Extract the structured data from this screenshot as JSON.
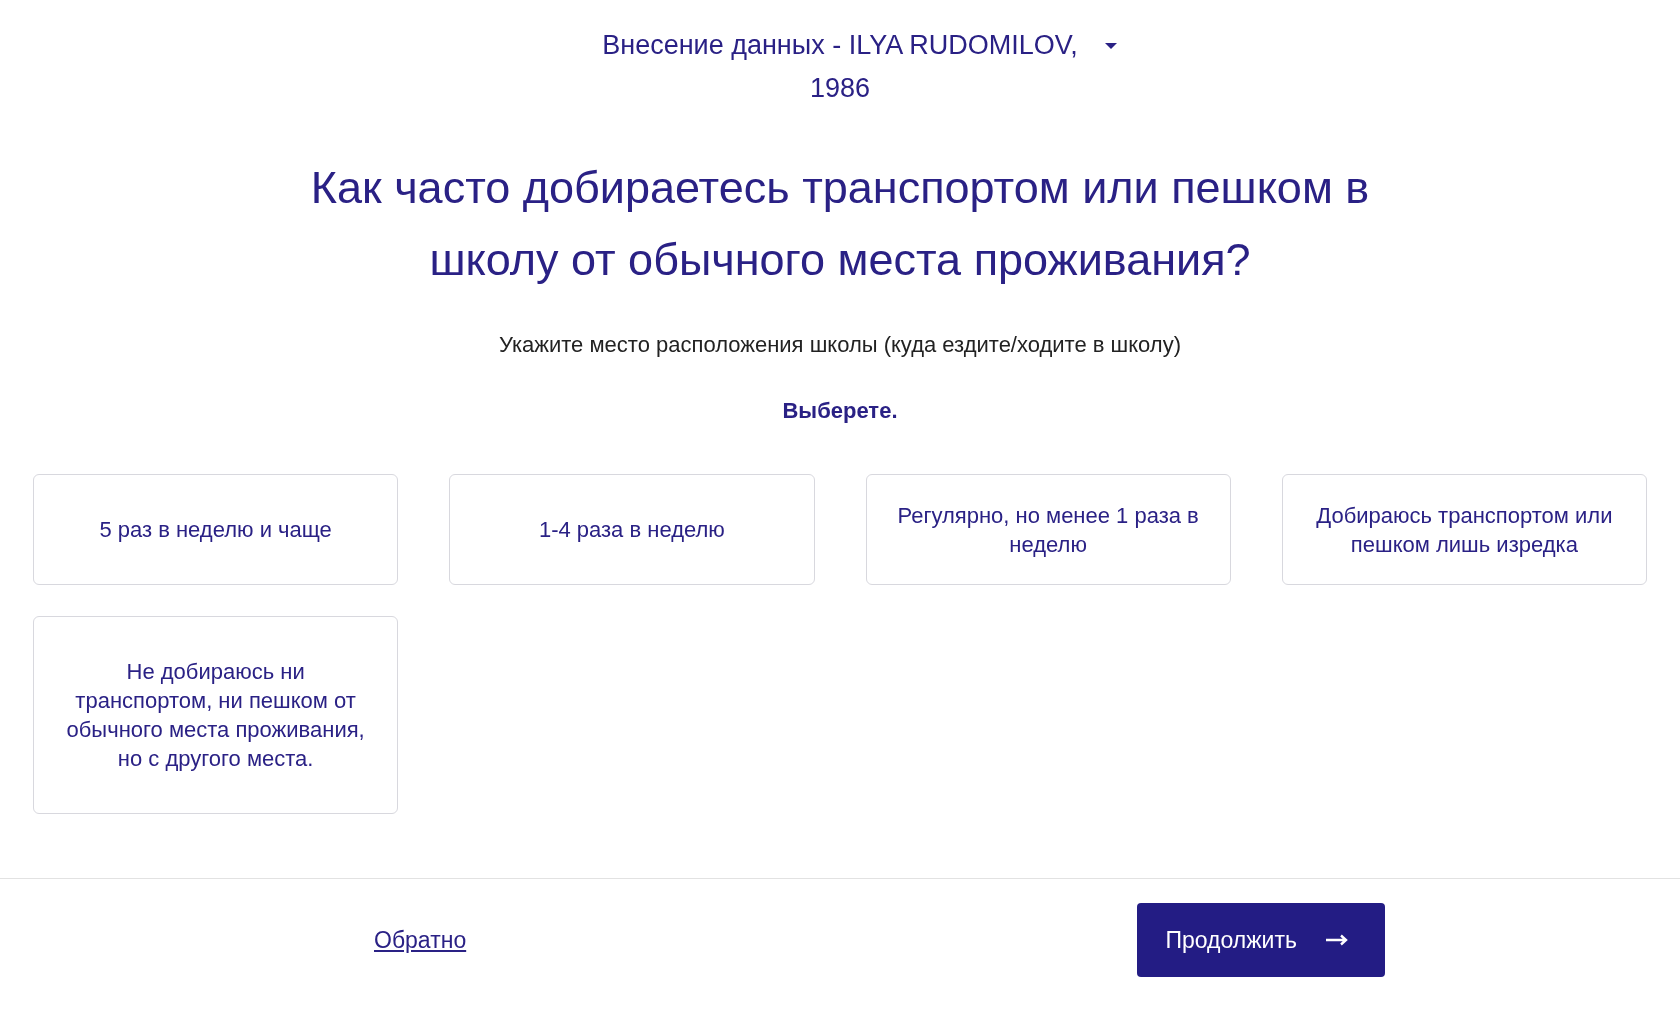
{
  "header": {
    "title": "Внесение данных - ILYA RUDOMILOV,",
    "subtitle": "1986"
  },
  "question": {
    "title": "Как часто добираетесь транспортом или пешком в школу от обычного места проживания?",
    "hint": "Укажите место расположения школы (куда ездите/ходите в школу)",
    "instruction": "Выберете."
  },
  "options": [
    {
      "label": "5 раз в неделю и чаще",
      "selected": false
    },
    {
      "label": "1-4 раза в неделю",
      "selected": false
    },
    {
      "label": "Регулярно, но менее 1 раза в неделю",
      "selected": false
    },
    {
      "label": "Добираюсь транспортом или пешком лишь изредка",
      "selected": false
    },
    {
      "label": "Не добираюсь ни транспортом, ни пешком от обычного места проживания, но с другого места.",
      "selected": false
    }
  ],
  "footer": {
    "back": "Обратно",
    "next": "Продолжить"
  }
}
